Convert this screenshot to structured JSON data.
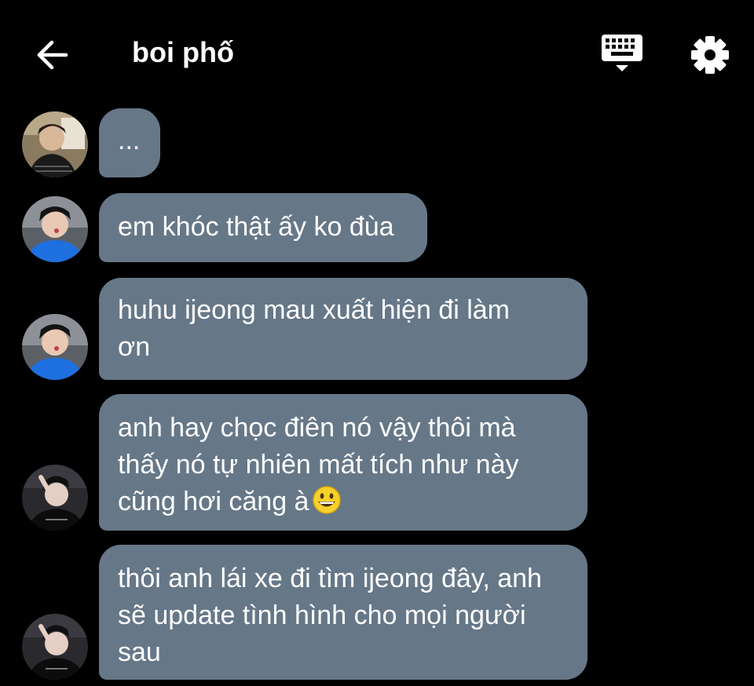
{
  "header": {
    "title": "boi phố",
    "back_icon": "arrow-left-icon",
    "keyboard_icon": "keyboard-icon",
    "settings_icon": "gear-icon"
  },
  "colors": {
    "background": "#000000",
    "bubble": "#667788",
    "text": "#ffffff"
  },
  "messages": [
    {
      "lines": [
        "..."
      ],
      "emoji": ""
    },
    {
      "lines": [
        "em khóc thật ấy ko đùa"
      ],
      "emoji": ""
    },
    {
      "lines": [
        "huhu ijeong mau xuất hiện đi làm",
        "ơn"
      ],
      "emoji": ""
    },
    {
      "lines": [
        "anh hay chọc điên nó vậy thôi mà",
        "thấy nó tự nhiên mất tích như này",
        "cũng hơi căng à"
      ],
      "emoji": "grinning-face-emoji"
    },
    {
      "lines": [
        "thôi anh lái xe đi tìm ijeong đây, anh",
        "sẽ update tình hình cho mọi người",
        "sau"
      ],
      "emoji": ""
    }
  ]
}
